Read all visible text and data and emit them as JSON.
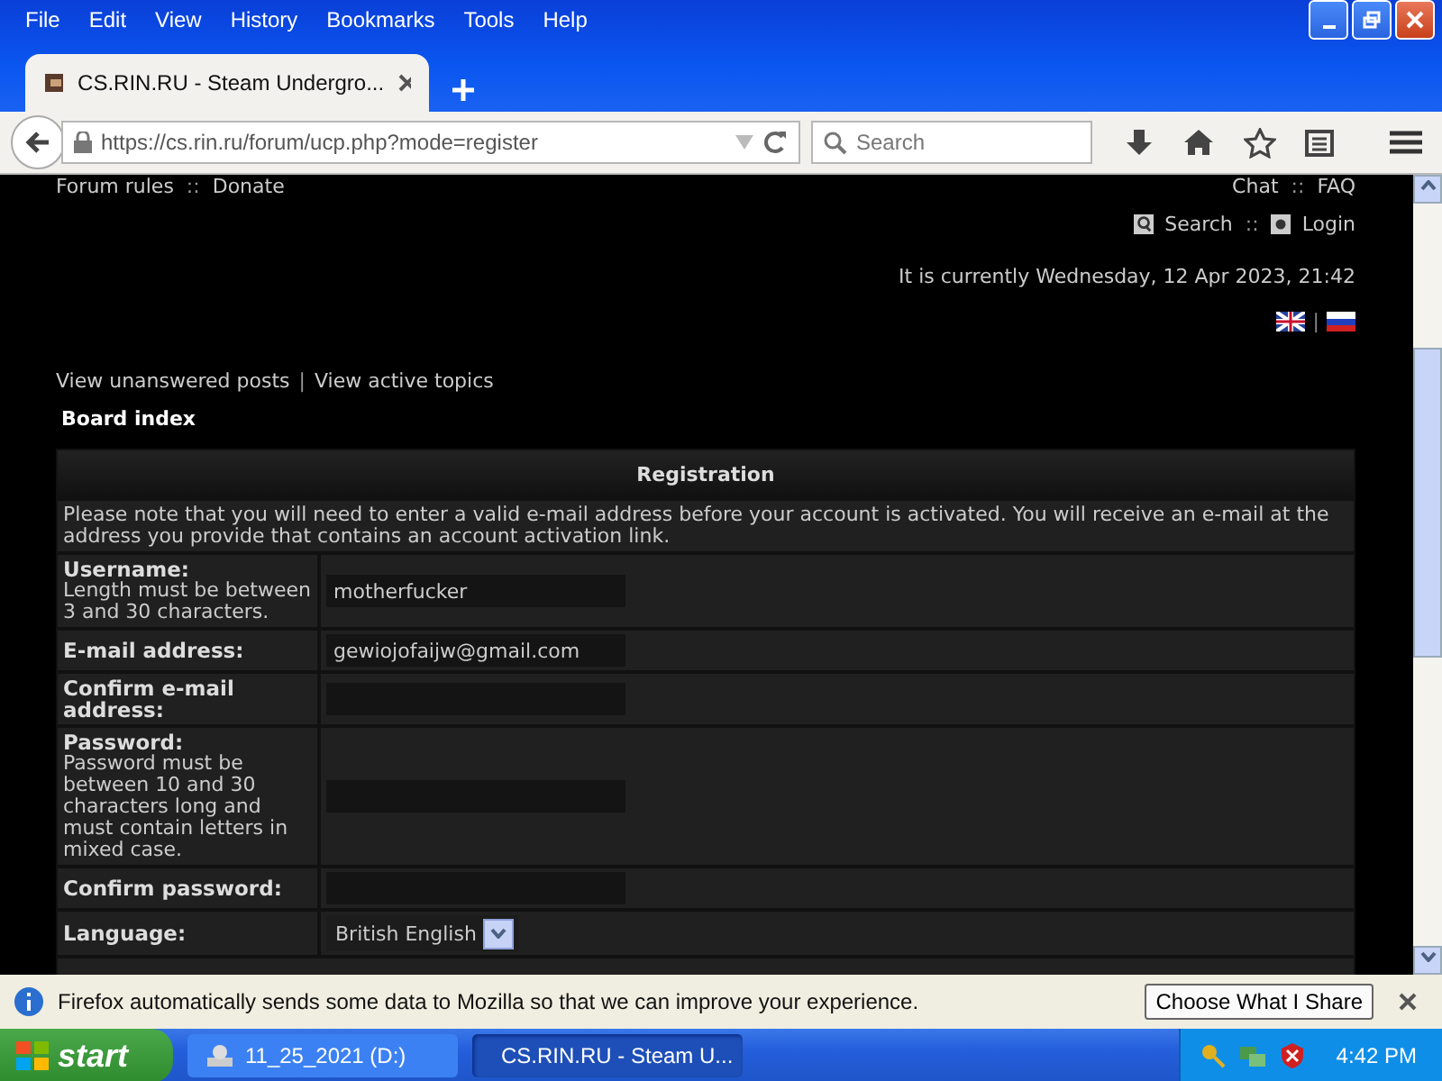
{
  "menu": [
    "File",
    "Edit",
    "View",
    "History",
    "Bookmarks",
    "Tools",
    "Help"
  ],
  "tabs": [
    {
      "title": "CS.RIN.RU - Steam Undergro...",
      "selected": true
    }
  ],
  "address": {
    "url": "https://cs.rin.ru/forum/ucp.php?mode=register"
  },
  "search": {
    "placeholder": "Search"
  },
  "page": {
    "top_links_left": [
      {
        "kind": "link",
        "text": "Forum rules"
      },
      {
        "kind": "separator",
        "text": "::"
      },
      {
        "kind": "link",
        "text": "Donate"
      }
    ],
    "top_links_right": [
      {
        "kind": "link",
        "text": "Chat"
      },
      {
        "kind": "separator",
        "text": "::"
      },
      {
        "kind": "link",
        "text": "FAQ"
      }
    ],
    "user_links": [
      {
        "kind": "link",
        "text": "Search"
      },
      {
        "kind": "separator",
        "text": "::"
      },
      {
        "kind": "link",
        "text": "Login"
      }
    ],
    "datetime": "It is currently Wednesday, 12 Apr 2023, 21:42",
    "flag_separator": "|",
    "nav_links": [
      {
        "kind": "link",
        "text": "View unanswered posts"
      },
      {
        "kind": "separator",
        "text": "|"
      },
      {
        "kind": "link",
        "text": "View active topics"
      }
    ],
    "breadcrumb": "Board index",
    "form": {
      "title": "Registration",
      "notice": "Please note that you will need to enter a valid e-mail address before your account is activated. You will receive an e-mail at the address you provide that contains an account activation link.",
      "fields": [
        {
          "kind": "text",
          "label": "Username:",
          "hint": "Length must be between 3 and 30 characters.",
          "value": "motherfucker"
        },
        {
          "kind": "text",
          "label": "E-mail address:",
          "value": "gewiojofaijw@gmail.com"
        },
        {
          "kind": "text",
          "label": "Confirm e-mail address:"
        },
        {
          "kind": "text",
          "label": "Password:",
          "hint": "Password must be between 10 and 30 characters long and must contain letters in mixed case."
        },
        {
          "kind": "text",
          "label": "Confirm password:"
        },
        {
          "kind": "select",
          "label": "Language:",
          "value": "British English"
        }
      ]
    }
  },
  "notification": {
    "message": "Firefox automatically sends some data to Mozilla so that we can improve your experience.",
    "button": "Choose What I Share"
  },
  "taskbar": {
    "start": "start",
    "items": [
      {
        "label": "11_25_2021 (D:)",
        "selected": false
      },
      {
        "label": "CS.RIN.RU - Steam U...",
        "selected": true
      }
    ],
    "clock": "4:42 PM"
  }
}
